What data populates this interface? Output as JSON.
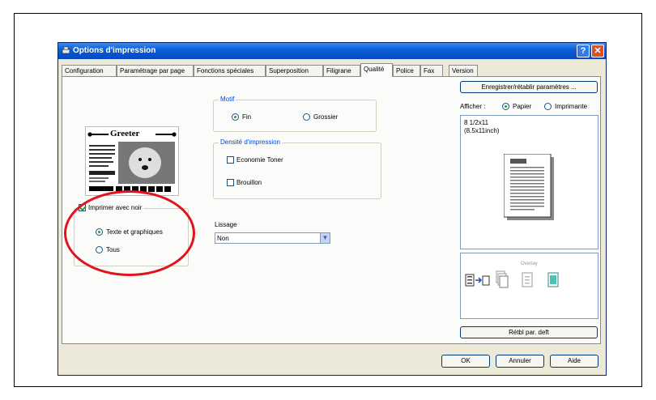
{
  "window": {
    "title": "Options d'impression"
  },
  "tabs": [
    {
      "label": "Configuration"
    },
    {
      "label": "Paramétrage par page"
    },
    {
      "label": "Fonctions spéciales"
    },
    {
      "label": "Superposition"
    },
    {
      "label": "Filigrane"
    },
    {
      "label": "Qualité"
    },
    {
      "label": "Police"
    },
    {
      "label": "Fax"
    },
    {
      "label": "Version"
    }
  ],
  "active_tab": "Qualité",
  "preview": {
    "heading": "Greeter"
  },
  "motif": {
    "label": "Motif",
    "options": [
      {
        "label": "Fin",
        "selected": true
      },
      {
        "label": "Grossier",
        "selected": false
      }
    ]
  },
  "density": {
    "label": "Densité d'impression",
    "economy_toner": {
      "label": "Economie Toner",
      "checked": false
    },
    "brouillon": {
      "label": "Brouillon",
      "checked": false
    }
  },
  "black": {
    "label": "Imprimer avec noir",
    "checked": true,
    "options": [
      {
        "label": "Texte et graphiques",
        "selected": true
      },
      {
        "label": "Tous",
        "selected": false
      }
    ]
  },
  "lissage": {
    "label": "Lissage",
    "value": "Non"
  },
  "right_panel": {
    "save_button": "Enregistrer/rétablir paramètres ...",
    "afficher_label": "Afficher :",
    "view_options": [
      {
        "label": "Papier",
        "selected": true
      },
      {
        "label": "Imprimante",
        "selected": false
      }
    ],
    "paper_size_line1": "8 1/2x11",
    "paper_size_line2": "(8.5x11inch)",
    "overlay_label": "Overlay",
    "reset_button": "Rétbl par. deft"
  },
  "footer": {
    "ok": "OK",
    "cancel": "Annuler",
    "help": "Aide"
  },
  "accent_colors": {
    "title_bar": "#0a5fd8",
    "highlight": "#e0141e",
    "group_label": "#0046d5"
  }
}
